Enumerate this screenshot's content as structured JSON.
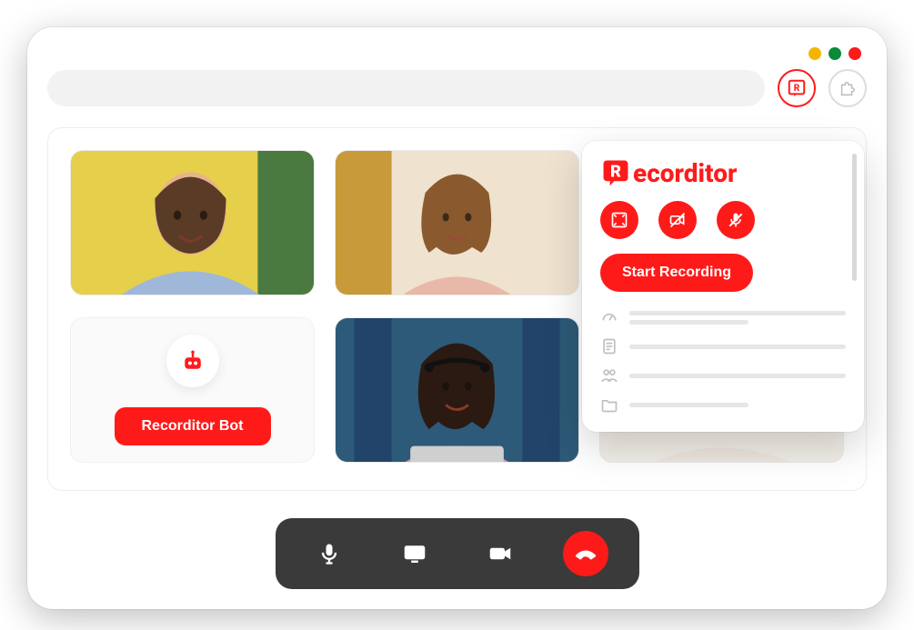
{
  "window": {
    "traffic_colors": {
      "min": "#f5b400",
      "max": "#0a8a3a",
      "close": "#ff1a1a"
    }
  },
  "toolbar": {
    "address_placeholder": "",
    "brand_icon_letter": "R"
  },
  "participants": [
    {
      "name": "participant-1"
    },
    {
      "name": "participant-2"
    },
    {
      "name": "participant-3"
    },
    {
      "name": "bot",
      "label": "Recorditor Bot"
    },
    {
      "name": "participant-5"
    },
    {
      "name": "participant-6"
    }
  ],
  "bot": {
    "button_label": "Recorditor Bot"
  },
  "controls": {
    "mic": "mic",
    "screen": "screen",
    "camera": "camera",
    "hangup": "hangup"
  },
  "panel": {
    "brand_name": "ecorditor",
    "brand_prefix": "R",
    "options": {
      "fullscreen": "fullscreen-icon",
      "no_camera": "camera-off-icon",
      "no_mic": "mic-off-icon"
    },
    "start_label": "Start Recording",
    "menu": [
      {
        "icon": "gauge-icon"
      },
      {
        "icon": "document-icon"
      },
      {
        "icon": "people-icon"
      },
      {
        "icon": "folder-icon"
      }
    ]
  },
  "colors": {
    "accent": "#ff1a1a"
  }
}
